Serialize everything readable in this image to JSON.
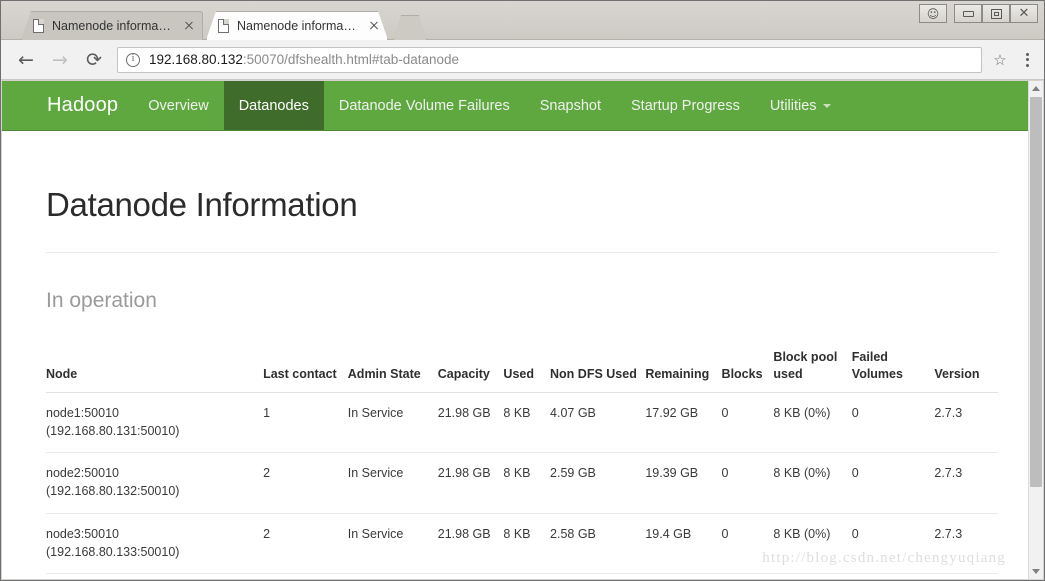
{
  "browser": {
    "tabs": [
      {
        "title": "Namenode information",
        "active": false,
        "icon": "page-icon"
      },
      {
        "title": "Namenode information",
        "active": true,
        "icon": "page-icon"
      }
    ],
    "new_tab_label": "",
    "window_controls": {
      "user_label": "☺",
      "minimize_label": "",
      "maximize_label": "",
      "close_label": "✕"
    },
    "toolbar": {
      "back_label": "←",
      "forward_label": "→",
      "reload_label": "⟳",
      "info_icon": "info-icon",
      "url_host": "192.168.80.132",
      "url_rest": ":50070/dfshealth.html#tab-datanode",
      "bookmark_label": "☆",
      "menu_label": "kebab-menu-icon"
    }
  },
  "hadoop_nav": {
    "brand": "Hadoop",
    "accent_color": "#5fa83f",
    "active_color": "#3f6b2b",
    "items": [
      {
        "label": "Overview",
        "active": false,
        "caret": false
      },
      {
        "label": "Datanodes",
        "active": true,
        "caret": false
      },
      {
        "label": "Datanode Volume Failures",
        "active": false,
        "caret": false
      },
      {
        "label": "Snapshot",
        "active": false,
        "caret": false
      },
      {
        "label": "Startup Progress",
        "active": false,
        "caret": false
      },
      {
        "label": "Utilities",
        "active": false,
        "caret": true
      }
    ]
  },
  "page": {
    "title": "Datanode Information",
    "section_title": "In operation",
    "watermark": "http://blog.csdn.net/chengyuqiang"
  },
  "table": {
    "headers": [
      "Node",
      "Last contact",
      "Admin State",
      "Capacity",
      "Used",
      "Non DFS Used",
      "Remaining",
      "Blocks",
      "Block pool used",
      "Failed Volumes",
      "Version"
    ],
    "rows": [
      {
        "node": "node1:50010\n(192.168.80.131:50010)",
        "last_contact": "1",
        "admin_state": "In Service",
        "capacity": "21.98 GB",
        "used": "8 KB",
        "non_dfs_used": "4.07 GB",
        "remaining": "17.92 GB",
        "blocks": "0",
        "block_pool_used": "8 KB (0%)",
        "failed_volumes": "0",
        "version": "2.7.3"
      },
      {
        "node": "node2:50010\n(192.168.80.132:50010)",
        "last_contact": "2",
        "admin_state": "In Service",
        "capacity": "21.98 GB",
        "used": "8 KB",
        "non_dfs_used": "2.59 GB",
        "remaining": "19.39 GB",
        "blocks": "0",
        "block_pool_used": "8 KB (0%)",
        "failed_volumes": "0",
        "version": "2.7.3"
      },
      {
        "node": "node3:50010\n(192.168.80.133:50010)",
        "last_contact": "2",
        "admin_state": "In Service",
        "capacity": "21.98 GB",
        "used": "8 KB",
        "non_dfs_used": "2.58 GB",
        "remaining": "19.4 GB",
        "blocks": "0",
        "block_pool_used": "8 KB (0%)",
        "failed_volumes": "0",
        "version": "2.7.3"
      }
    ]
  }
}
